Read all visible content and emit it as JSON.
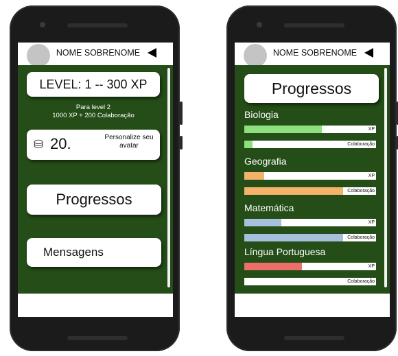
{
  "colors": {
    "background_green": "#244d17",
    "phone_body": "#1b1b1b",
    "bar_green": "#8ee07f",
    "bar_orange": "#f4b36b",
    "bar_blue": "#a7bfdb",
    "bar_red": "#ec6f6a"
  },
  "left_screen": {
    "user_name": "NOME SOBRENOME",
    "level_label": "LEVEL: 1 -- 300 XP",
    "next_level_line1": "Para level 2",
    "next_level_line2": "1000 XP + 200 Colaboração",
    "coin_icon": "coins-icon",
    "coin_value": "20.",
    "customize_label": "Personalize seu avatar",
    "progress_button": "Progressos",
    "messages_button": "Mensagens"
  },
  "right_screen": {
    "user_name": "NOME SOBRENOME",
    "title": "Progressos",
    "xp_label": "XP",
    "collab_label": "Colaboração",
    "subjects": [
      {
        "name": "Biologia",
        "xp_progress": 0.59,
        "collab_progress": 0.06,
        "color": "#8ee07f"
      },
      {
        "name": "Geografia",
        "xp_progress": 0.15,
        "collab_progress": 0.75,
        "color": "#f4b36b"
      },
      {
        "name": "Matemática",
        "xp_progress": 0.28,
        "collab_progress": 0.75,
        "color": "#a7bfdb"
      },
      {
        "name": "Língua Portuguesa",
        "xp_progress": 0.44,
        "collab_progress": 0.0,
        "color": "#ec6f6a"
      }
    ]
  }
}
